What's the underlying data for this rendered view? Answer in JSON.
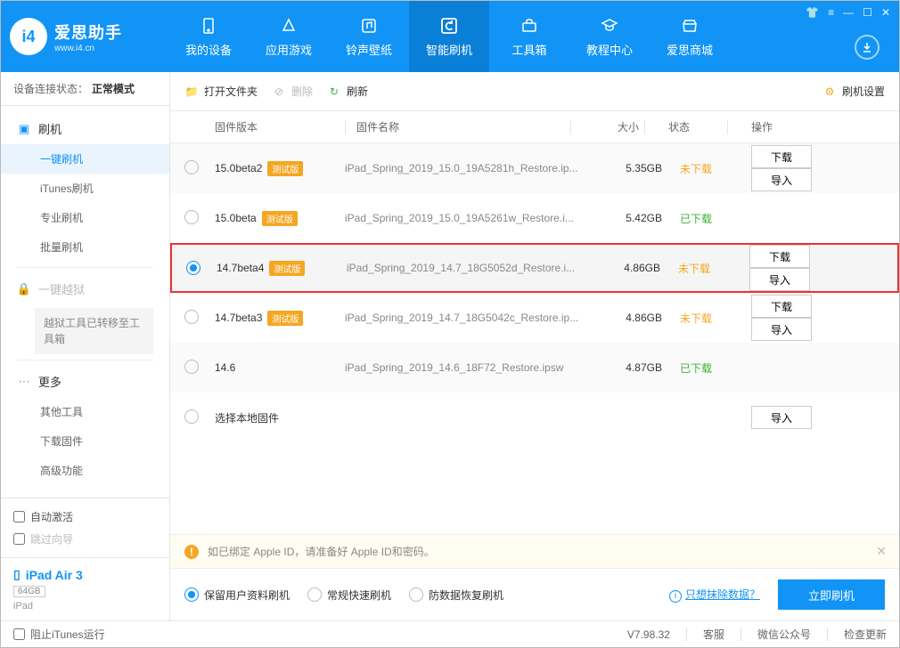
{
  "logo": {
    "main": "爱思助手",
    "sub": "www.i4.cn",
    "glyph": "i4"
  },
  "nav": [
    {
      "label": "我的设备"
    },
    {
      "label": "应用游戏"
    },
    {
      "label": "铃声壁纸"
    },
    {
      "label": "智能刷机",
      "active": true
    },
    {
      "label": "工具箱"
    },
    {
      "label": "教程中心"
    },
    {
      "label": "爱思商城"
    }
  ],
  "sidebar": {
    "conn_label": "设备连接状态：",
    "conn_value": "正常模式",
    "flash_cat": "刷机",
    "subs": [
      "一键刷机",
      "iTunes刷机",
      "专业刷机",
      "批量刷机"
    ],
    "jail_cat": "一键越狱",
    "jail_note": "越狱工具已转移至工具箱",
    "more_cat": "更多",
    "more_subs": [
      "其他工具",
      "下载固件",
      "高级功能"
    ],
    "auto_activate": "自动激活",
    "skip_guide": "跳过向导",
    "device_name": "iPad Air 3",
    "device_storage": "64GB",
    "device_type": "iPad"
  },
  "toolbar": {
    "open": "打开文件夹",
    "delete": "删除",
    "refresh": "刷新",
    "settings": "刷机设置"
  },
  "columns": {
    "version": "固件版本",
    "name": "固件名称",
    "size": "大小",
    "status": "状态",
    "ops": "操作"
  },
  "tag_beta": "测试版",
  "btn_download": "下载",
  "btn_import": "导入",
  "status_no": "未下载",
  "status_yes": "已下载",
  "rows": [
    {
      "ver": "15.0beta2",
      "beta": true,
      "name": "iPad_Spring_2019_15.0_19A5281h_Restore.ip...",
      "size": "5.35GB",
      "downloaded": false,
      "ops": true
    },
    {
      "ver": "15.0beta",
      "beta": true,
      "name": "iPad_Spring_2019_15.0_19A5261w_Restore.i...",
      "size": "5.42GB",
      "downloaded": true,
      "ops": false
    },
    {
      "ver": "14.7beta4",
      "beta": true,
      "name": "iPad_Spring_2019_14.7_18G5052d_Restore.i...",
      "size": "4.86GB",
      "downloaded": false,
      "ops": true,
      "selected": true,
      "highlight": true
    },
    {
      "ver": "14.7beta3",
      "beta": true,
      "name": "iPad_Spring_2019_14.7_18G5042c_Restore.ip...",
      "size": "4.86GB",
      "downloaded": false,
      "ops": true
    },
    {
      "ver": "14.6",
      "beta": false,
      "name": "iPad_Spring_2019_14.6_18F72_Restore.ipsw",
      "size": "4.87GB",
      "downloaded": true,
      "ops": false
    }
  ],
  "local_row": "选择本地固件",
  "alert": "如已绑定 Apple ID，请准备好 Apple ID和密码。",
  "flash_opts": [
    "保留用户资料刷机",
    "常规快速刷机",
    "防数据恢复刷机"
  ],
  "erase_link": "只想抹除数据？",
  "flash_btn": "立即刷机",
  "footer": {
    "block_itunes": "阻止iTunes运行",
    "version": "V7.98.32",
    "cs": "客服",
    "wechat": "微信公众号",
    "update": "检查更新"
  }
}
